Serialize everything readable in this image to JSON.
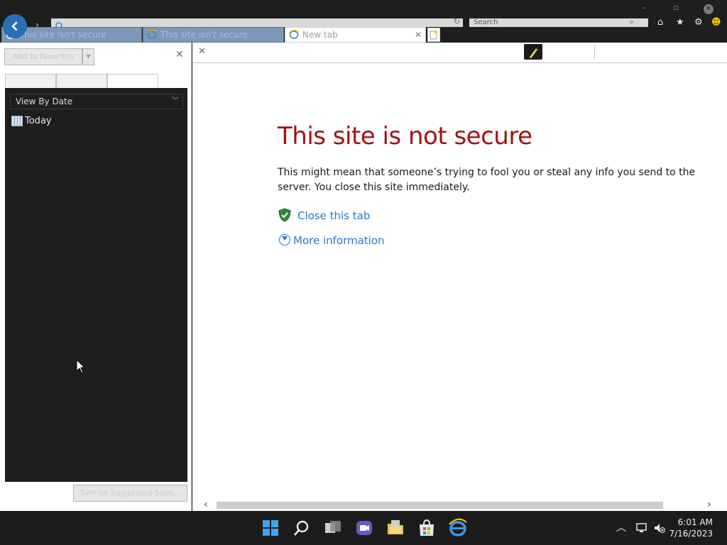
{
  "browser": {
    "search_placeholder": "Search",
    "tabs": [
      {
        "title": "This site isn't secure"
      },
      {
        "title": "This site isn't secure"
      },
      {
        "title": "New tab"
      }
    ],
    "colors": {
      "tab_inactive": "#7d98b8",
      "accent": "#2a78c4",
      "error_title": "#a11313"
    }
  },
  "sidebar": {
    "add_button": "Add to favorites",
    "view_select": "View By Date",
    "history_items": [
      {
        "label": "Today",
        "icon": "calendar-icon"
      }
    ],
    "suggest_button": "Turn on Suggested Sites..."
  },
  "page": {
    "title": "This site is not secure",
    "body": "This might mean that someone’s trying to fool you or steal any info you send to the server. You close this site immediately.",
    "close_tab_link": "Close this tab",
    "more_info_link": "More information"
  },
  "taskbar": {
    "time": "6:01 AM",
    "date": "7/16/2023"
  }
}
